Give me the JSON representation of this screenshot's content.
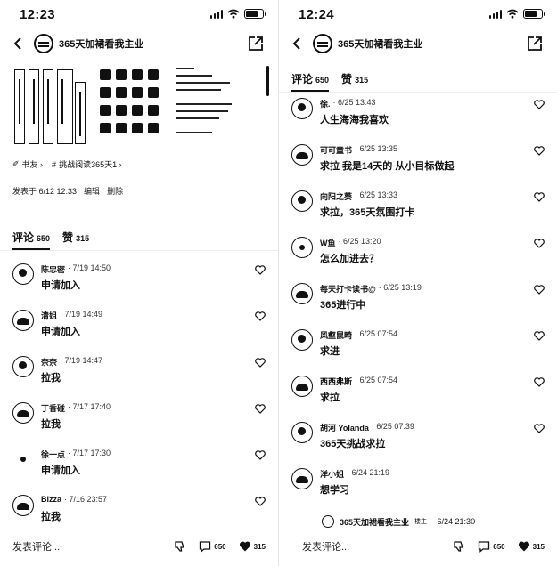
{
  "left": {
    "time": "12:23",
    "nav": {
      "title": "365天加裙看我主业"
    },
    "tags": [
      {
        "icon": "✐",
        "label": "书友 ›"
      },
      {
        "icon": "#",
        "label": "挑战阅读365天1 ›"
      }
    ],
    "post_meta": {
      "published": "发表于 6/12 12:33",
      "edit": "编辑",
      "delete": "删除"
    },
    "tabs": {
      "comments_label": "评论",
      "comments_count": "650",
      "likes_label": "赞",
      "likes_count": "315"
    },
    "comments": [
      {
        "name": "陈忠密",
        "time": "· 7/19 14:50",
        "text": "申请加入"
      },
      {
        "name": "清姐",
        "time": "· 7/19 14:49",
        "text": "申请加入"
      },
      {
        "name": "奈奈",
        "time": "· 7/19 14:47",
        "text": "拉我"
      },
      {
        "name": "丁香碰",
        "time": "· 7/17 17:40",
        "text": "拉我"
      },
      {
        "name": "徐一点",
        "time": "· 7/17 17:30",
        "text": "申请加入"
      },
      {
        "name": "Bizza",
        "time": "· 7/16 23:57",
        "text": "拉我"
      }
    ],
    "bottom": {
      "placeholder": "发表评论...",
      "comments_count": "650",
      "likes_count": "315"
    }
  },
  "right": {
    "time": "12:24",
    "nav": {
      "title": "365天加裙看我主业"
    },
    "tabs": {
      "comments_label": "评论",
      "comments_count": "650",
      "likes_label": "赞",
      "likes_count": "315"
    },
    "comments": [
      {
        "name": "徐.",
        "time": "· 6/25 13:43",
        "text": "人生海海我喜欢"
      },
      {
        "name": "可可童书",
        "time": "· 6/25 13:35",
        "text": "求拉 我是14天的 从小目标做起"
      },
      {
        "name": "向阳之葵",
        "time": "· 6/25 13:33",
        "text": "求拉，365天氛围打卡"
      },
      {
        "name": "W鱼",
        "time": "· 6/25 13:20",
        "text": "怎么加进去？"
      },
      {
        "name": "每天打卡读书@",
        "time": "· 6/25 13:19",
        "text": "365进行中"
      },
      {
        "name": "风壑鼠畸",
        "time": "· 6/25 07:54",
        "text": "求进"
      },
      {
        "name": "西西弗斯",
        "time": "· 6/25 07:54",
        "text": "求拉"
      },
      {
        "name": "胡河 Yolanda",
        "time": "· 6/25 07:39",
        "text": "365天挑战求拉"
      },
      {
        "name": "洋小姐",
        "time": "· 6/24 21:19",
        "text": "想学习"
      }
    ],
    "reply": {
      "name": "365天加裙看我主业",
      "badge": "楼主",
      "time": "· 6/24 21:30"
    },
    "bottom": {
      "placeholder": "发表评论...",
      "comments_count": "650",
      "likes_count": "315"
    }
  }
}
